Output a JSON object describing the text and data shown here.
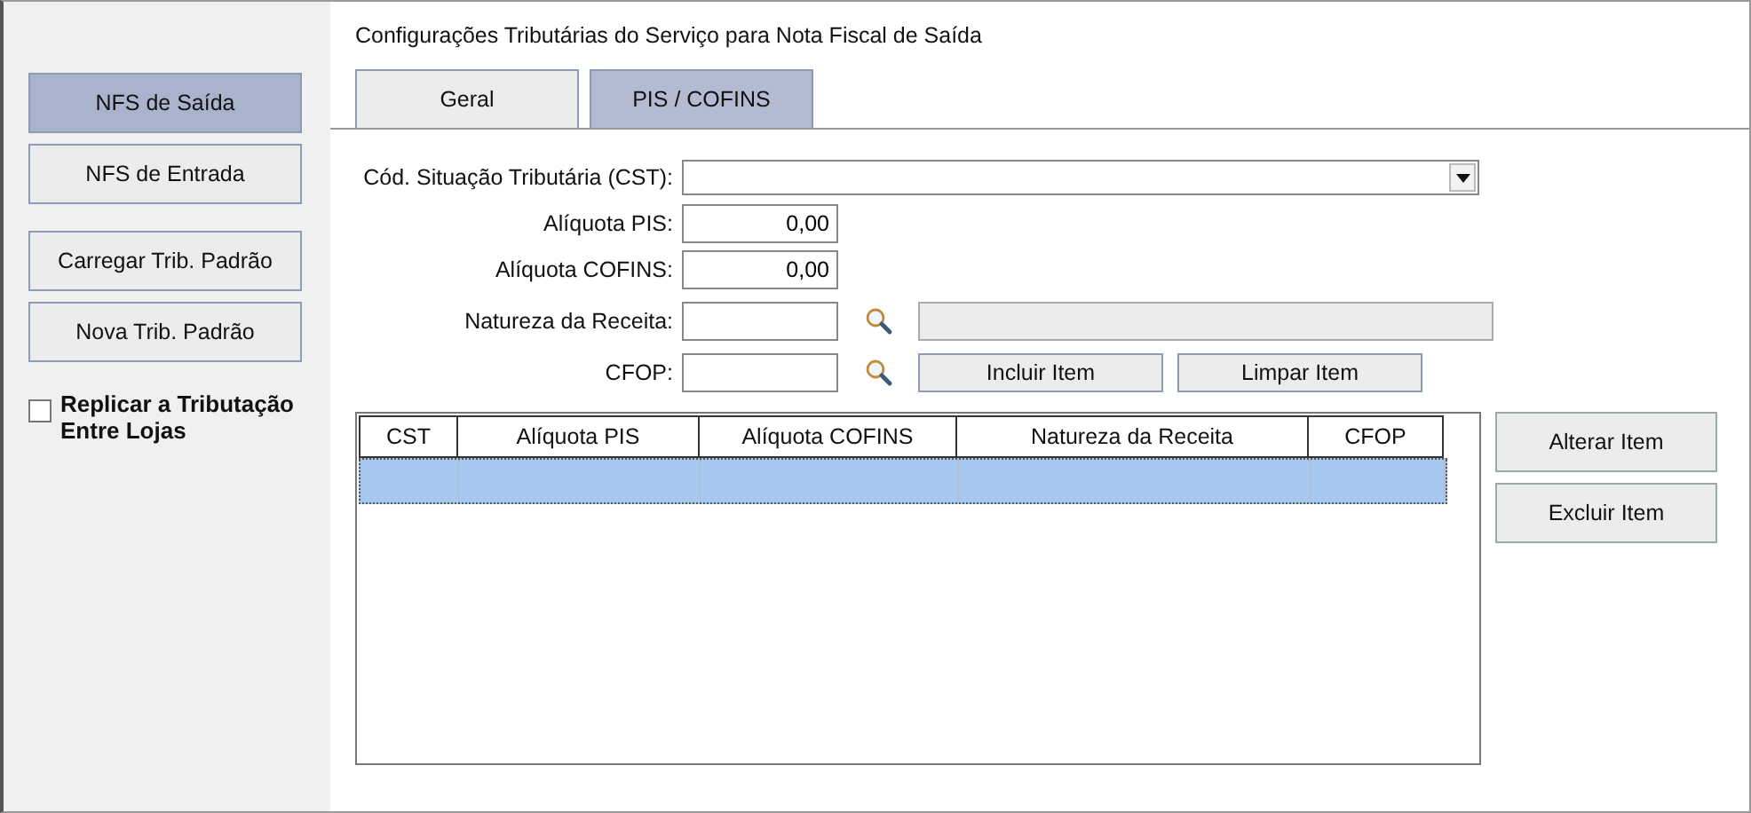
{
  "sidebar": {
    "buttons": [
      {
        "label": "NFS de Saída",
        "selected": true
      },
      {
        "label": "NFS de Entrada",
        "selected": false
      },
      {
        "label": "Carregar Trib. Padrão",
        "selected": false
      },
      {
        "label": "Nova Trib. Padrão",
        "selected": false
      }
    ],
    "replicate": {
      "label": "Replicar a Tributação Entre Lojas",
      "checked": false
    }
  },
  "title": "Configurações Tributárias do Serviço para Nota Fiscal de Saída",
  "tabs": [
    {
      "label": "Geral",
      "selected": false
    },
    {
      "label": "PIS / COFINS",
      "selected": true
    }
  ],
  "form": {
    "cst_label": "Cód. Situação Tributária (CST):",
    "pis_label": "Alíquota PIS:",
    "pis_value": "0,00",
    "cofins_label": "Alíquota COFINS:",
    "cofins_value": "0,00",
    "natureza_label": "Natureza da Receita:",
    "cfop_label": "CFOP:",
    "include_button": "Incluir Item",
    "clear_button": "Limpar Item"
  },
  "table": {
    "columns": [
      "CST",
      "Alíquota PIS",
      "Alíquota COFINS",
      "Natureza da Receita",
      "CFOP"
    ],
    "rows": [
      {
        "selected": true
      }
    ]
  },
  "side_buttons": [
    "Alterar Item",
    "Excluir Item"
  ]
}
